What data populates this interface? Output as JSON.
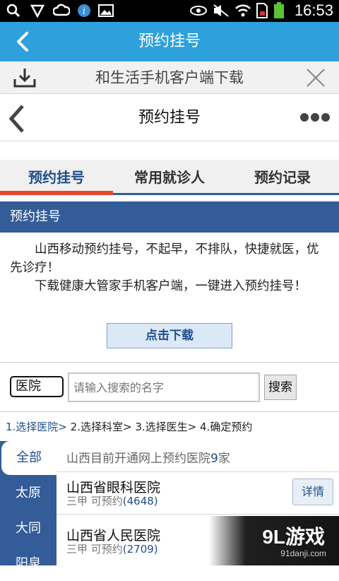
{
  "status_bar": {
    "time": "16:53",
    "icons": [
      "search-icon",
      "shield-icon",
      "cloud-icon",
      "info-icon",
      "image-icon",
      "eye-icon",
      "mute-icon",
      "wifi-icon",
      "sim-icon",
      "battery-icon"
    ]
  },
  "app_header": {
    "title": "预约挂号"
  },
  "banner": {
    "text": "和生活手机客户端下载"
  },
  "page_nav": {
    "title": "预约挂号"
  },
  "tabs": [
    {
      "label": "预约挂号"
    },
    {
      "label": "常用就诊人"
    },
    {
      "label": "预约记录"
    }
  ],
  "section": {
    "title": "预约挂号"
  },
  "intro": {
    "p1": "山西移动预约挂号，不起早，不排队，快捷就医，优先诊疗！",
    "p2": "下载健康大管家手机客户端，一键进入预约挂号！"
  },
  "download_button": "点击下载",
  "search": {
    "type_label": "医院",
    "placeholder": "请输入搜索的名字",
    "button": "搜索"
  },
  "steps": {
    "s1": "1.选择医院>",
    "s2": "2.选择科室>",
    "s3": "3.选择医生>",
    "s4": "4.确定预约"
  },
  "categories": [
    "全部",
    "太原",
    "大同",
    "阳泉"
  ],
  "summary": {
    "prefix": "山西目前开通网上预约医院",
    "count": "9",
    "suffix": "家"
  },
  "hospitals": [
    {
      "name": "山西省眼科医院",
      "level": "三甲 可预约",
      "count": "(4648)",
      "detail": "详情"
    },
    {
      "name": "山西省人民医院",
      "level": "三甲 可预约",
      "count": "(2709)"
    }
  ],
  "watermark": {
    "brand": "9L游戏",
    "site": "91danji.com"
  },
  "colors": {
    "header": "#2ea1dc",
    "navy": "#335c99",
    "accent": "#e8462a"
  }
}
